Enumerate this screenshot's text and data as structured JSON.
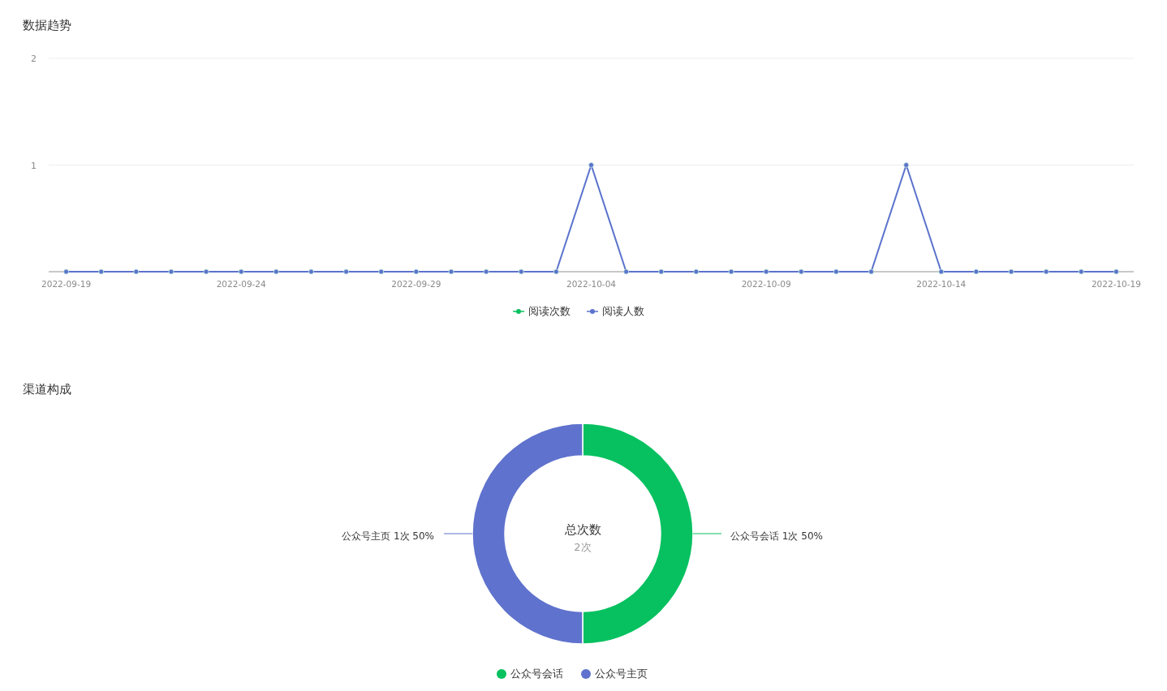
{
  "trend": {
    "title": "数据趋势",
    "chart_data": {
      "type": "line",
      "categories": [
        "2022-09-19",
        null,
        null,
        null,
        null,
        "2022-09-24",
        null,
        null,
        null,
        null,
        "2022-09-29",
        null,
        null,
        null,
        null,
        "2022-10-04",
        null,
        null,
        null,
        null,
        "2022-10-09",
        null,
        null,
        null,
        null,
        "2022-10-14",
        null,
        null,
        null,
        null,
        "2022-10-19"
      ],
      "ylim": [
        0,
        2
      ],
      "yticks": [
        1,
        2
      ],
      "series": [
        {
          "name": "阅读次数",
          "color": "#07c160",
          "marker": "circle",
          "values": [
            null,
            null,
            null,
            null,
            null,
            null,
            null,
            null,
            null,
            null,
            null,
            null,
            null,
            null,
            null,
            null,
            null,
            null,
            null,
            null,
            null,
            null,
            null,
            null,
            null,
            null,
            null,
            null,
            null,
            null,
            null
          ]
        },
        {
          "name": "阅读人数",
          "color": "#5b73cc",
          "marker": "circle",
          "values": [
            0,
            0,
            0,
            0,
            0,
            0,
            0,
            0,
            0,
            0,
            0,
            0,
            0,
            0,
            0,
            1,
            0,
            0,
            0,
            0,
            0,
            0,
            0,
            0,
            1,
            0,
            0,
            0,
            0,
            0,
            0
          ]
        }
      ]
    }
  },
  "channels": {
    "title": "渠道构成",
    "center_title": "总次数",
    "center_value": "2次",
    "chart_data": {
      "type": "donut",
      "categories": [
        "公众号会话",
        "公众号主页"
      ],
      "colors": [
        "#07c160",
        "#5f72cd"
      ],
      "series": [
        {
          "values": [
            50,
            50
          ]
        }
      ],
      "value_labels": [
        "公众号会话 1次 50%",
        "公众号主页 1次 50%"
      ]
    }
  }
}
